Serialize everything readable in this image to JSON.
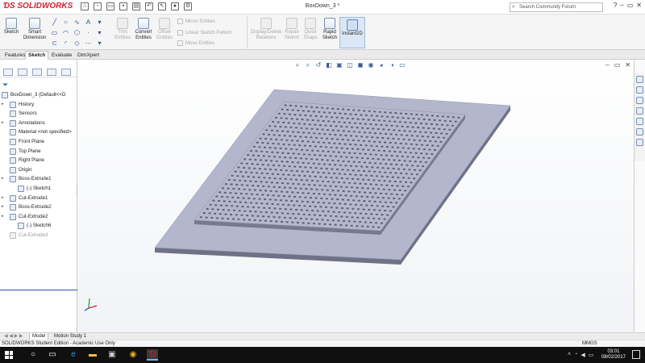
{
  "app": {
    "logo_text": "SOLIDWORKS",
    "window_title": "BoxDown_3 *",
    "search_placeholder": "Search Community Forum"
  },
  "ribbon": {
    "sketch": "Sketch",
    "smart_dimension_1": "Smart",
    "smart_dimension_2": "Dimension",
    "trim_1": "Trim",
    "trim_2": "Entities",
    "convert_1": "Convert",
    "convert_2": "Entities",
    "offset_1": "Offset",
    "offset_2": "Entities",
    "mirror": "Mirror Entities",
    "linear_pattern": "Linear Sketch Pattern",
    "move": "Move Entities",
    "display_delete_1": "Display/Delete",
    "display_delete_2": "Relations",
    "repair_1": "Repair",
    "repair_2": "Sketch",
    "quick_snaps_1": "Quick",
    "quick_snaps_2": "Snaps",
    "rapid_1": "Rapid",
    "rapid_2": "Sketch",
    "instant2d": "Instant2D"
  },
  "tabs": [
    "Features",
    "Sketch",
    "Evaluate",
    "DimXpert"
  ],
  "selected_tab": "Sketch",
  "tree": {
    "root": "BoxDown_3  (Default<<D",
    "items": [
      {
        "label": "History",
        "icon": "history-icon"
      },
      {
        "label": "Sensors",
        "icon": "sensors-icon"
      },
      {
        "label": "Annotations",
        "icon": "annotations-icon"
      },
      {
        "label": "Material <not specified>",
        "icon": "material-icon"
      },
      {
        "label": "Front Plane",
        "icon": "plane-icon"
      },
      {
        "label": "Top Plane",
        "icon": "plane-icon"
      },
      {
        "label": "Right Plane",
        "icon": "plane-icon"
      },
      {
        "label": "Origin",
        "icon": "origin-icon"
      },
      {
        "label": "Boss-Extrude1",
        "icon": "boss-extrude-icon"
      },
      {
        "label": "(-) Sketch1",
        "icon": "sketch-icon"
      },
      {
        "label": "Cut-Extrude1",
        "icon": "cut-extrude-icon"
      },
      {
        "label": "Boss-Extrude2",
        "icon": "boss-extrude-icon"
      },
      {
        "label": "Cut-Extrude2",
        "icon": "cut-extrude-icon"
      },
      {
        "label": "(-) Sketch6",
        "icon": "sketch-icon"
      },
      {
        "label": "Cut-Extrude3",
        "icon": "cut-extrude-icon"
      }
    ]
  },
  "bottom_tabs": [
    "Model",
    "Motion Study 1"
  ],
  "status": {
    "edition": "SOLIDWORKS Student Edition - Academic Use Only",
    "units": "MMGS"
  },
  "taskbar": {
    "time": "03:01",
    "date": "08/02/2017"
  },
  "colors": {
    "accent": "#d41f2e",
    "model_top": "#b3b6cc",
    "model_side": "#6f7286",
    "hole": "#5c5f74"
  }
}
